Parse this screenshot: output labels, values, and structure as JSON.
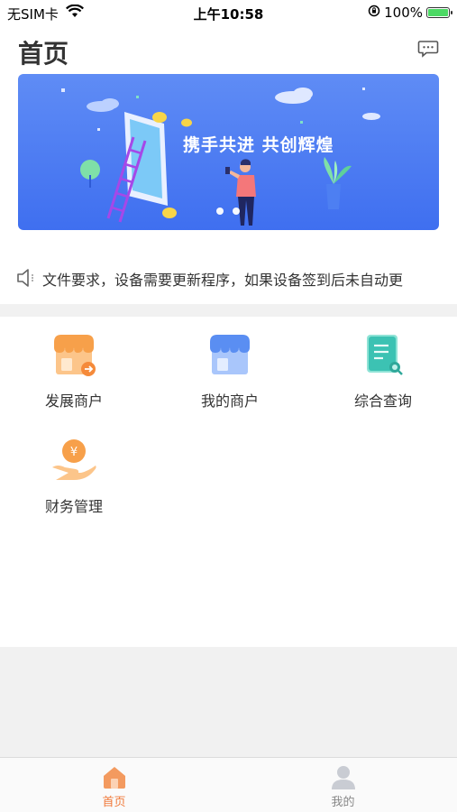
{
  "status_bar": {
    "carrier": "无SIM卡",
    "time": "上午10:58",
    "battery": "100%"
  },
  "header": {
    "title": "首页",
    "message_icon": "chat-bubble-icon"
  },
  "banner": {
    "slogan": "携手共进 共创辉煌",
    "page_count": 2
  },
  "notice": {
    "icon": "speaker-icon",
    "text": "文件要求，设备需要更新程序，如果设备签到后未自动更"
  },
  "grid": {
    "items": [
      {
        "label": "发展商户",
        "icon": "store-add-icon",
        "color": "#f5a04a"
      },
      {
        "label": "我的商户",
        "icon": "store-icon",
        "color": "#5a8ef2"
      },
      {
        "label": "综合查询",
        "icon": "document-search-icon",
        "color": "#3cc2b3"
      },
      {
        "label": "财务管理",
        "icon": "money-hand-icon",
        "color": "#f5a04a"
      }
    ]
  },
  "tab_bar": {
    "tabs": [
      {
        "label": "首页",
        "icon": "home-icon",
        "active": true
      },
      {
        "label": "我的",
        "icon": "user-icon",
        "active": false
      }
    ],
    "accent": "#f07a3a"
  }
}
